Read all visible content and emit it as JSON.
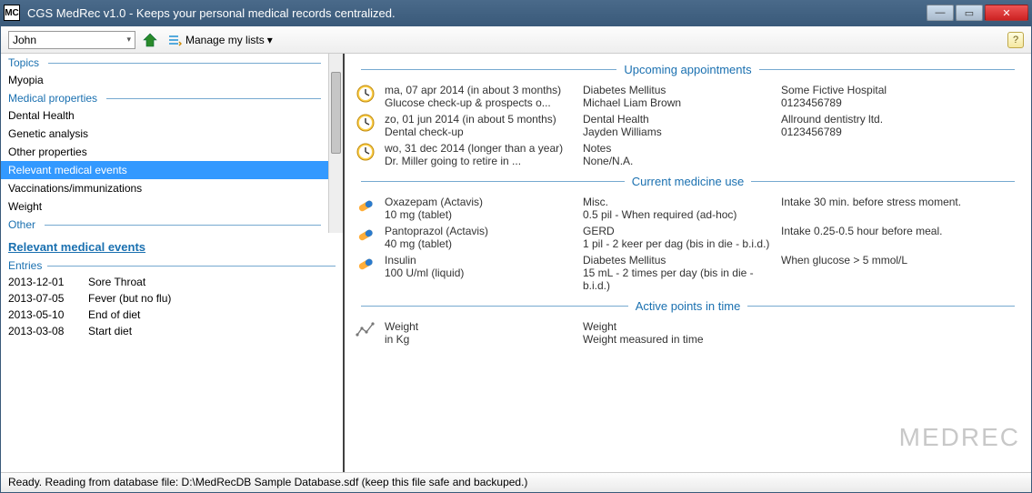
{
  "window": {
    "logo": "MC",
    "title": "CGS MedRec v1.0 - Keeps your personal medical records centralized."
  },
  "toolbar": {
    "user": "John",
    "manage": "Manage my lists",
    "help": "?"
  },
  "sidebar": {
    "section_topics": "Topics",
    "topics": [
      "Myopia"
    ],
    "section_medprops": "Medical properties",
    "medprops": [
      "Dental Health",
      "Genetic analysis",
      "Other properties",
      "Relevant medical events",
      "Vaccinations/immunizations",
      "Weight"
    ],
    "section_other": "Other",
    "detail_link": "Relevant medical events",
    "entries_hdr": "Entries",
    "entries": [
      {
        "date": "2013-12-01",
        "text": "Sore Throat"
      },
      {
        "date": "2013-07-05",
        "text": "Fever (but no flu)"
      },
      {
        "date": "2013-05-10",
        "text": "End of diet"
      },
      {
        "date": "2013-03-08",
        "text": "Start diet"
      }
    ]
  },
  "right": {
    "appointments_hdr": "Upcoming appointments",
    "appointments": [
      {
        "l1": "ma, 07 apr 2014 (in about 3 months)",
        "l2": "Glucose check-up & prospects o...",
        "m1": "Diabetes Mellitus",
        "m2": "Michael Liam Brown",
        "r1": "Some Fictive Hospital",
        "r2": "0123456789"
      },
      {
        "l1": "zo, 01 jun 2014 (in about 5 months)",
        "l2": "Dental check-up",
        "m1": "Dental Health",
        "m2": "Jayden Williams",
        "r1": "Allround dentistry ltd.",
        "r2": "0123456789"
      },
      {
        "l1": "wo, 31 dec 2014 (longer than a year)",
        "l2": "Dr. Miller going to retire in ...",
        "m1": "Notes",
        "m2": "None/N.A.",
        "r1": "",
        "r2": ""
      }
    ],
    "medicine_hdr": "Current medicine use",
    "medicines": [
      {
        "l1": "Oxazepam (Actavis)",
        "l2": "10 mg (tablet)",
        "m1": "Misc.",
        "m2": "0.5 pil - When required (ad-hoc)",
        "r1": "Intake 30 min. before stress moment."
      },
      {
        "l1": "Pantoprazol (Actavis)",
        "l2": "40 mg (tablet)",
        "m1": "GERD",
        "m2": "1 pil - 2 keer per dag (bis in die - b.i.d.)",
        "r1": "Intake 0.25-0.5 hour before meal."
      },
      {
        "l1": "Insulin",
        "l2": "100 U/ml (liquid)",
        "m1": "Diabetes Mellitus",
        "m2": "15 mL - 2 times per day (bis in die - b.i.d.)",
        "r1": "When glucose > 5 mmol/L"
      }
    ],
    "active_hdr": "Active points in time",
    "active": [
      {
        "l1": "Weight",
        "l2": "in Kg",
        "m1": "Weight",
        "m2": "Weight measured in time"
      }
    ]
  },
  "watermark": "MEDREC",
  "status": "Ready. Reading from database file: D:\\MedRecDB Sample Database.sdf (keep this file safe and backuped.)"
}
